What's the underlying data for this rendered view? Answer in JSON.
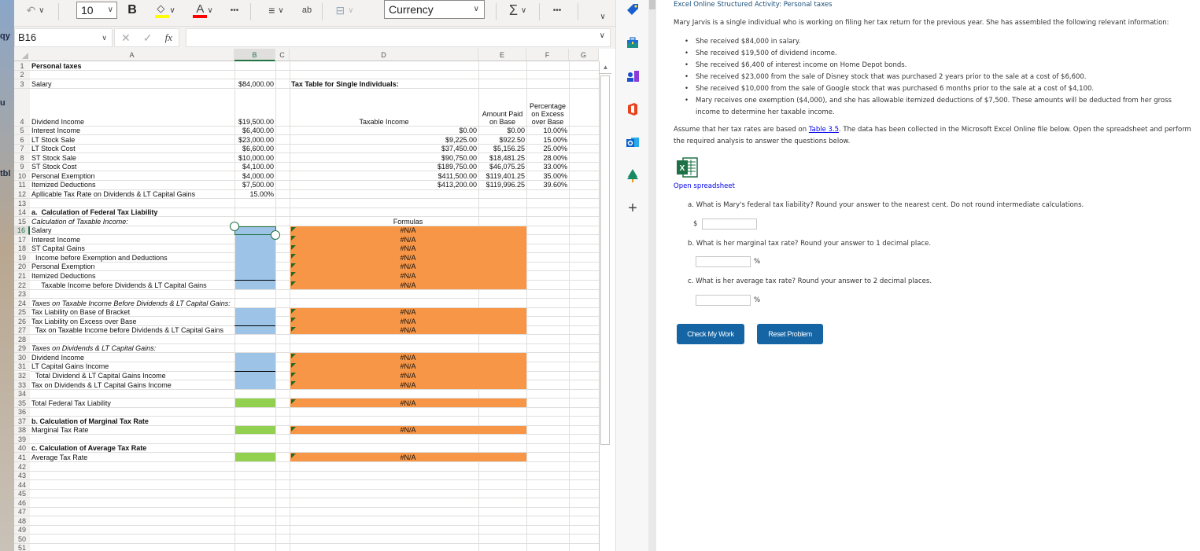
{
  "toolbar": {
    "undo_icon": "undo-icon",
    "font_size": "10",
    "bold_label": "B",
    "fill_color": "#ffff00",
    "font_color": "#ff0000",
    "font_color_label": "A",
    "more_label": "•••",
    "wrap_label": "ab",
    "number_format": "Currency",
    "autosum_label": "Σ",
    "more2_label": "•••"
  },
  "formula_bar": {
    "name_box": "B16",
    "cancel_label": "✕",
    "enter_label": "✓",
    "fx_label": "fx",
    "formula_value": ""
  },
  "grid": {
    "columns": [
      "A",
      "B",
      "C",
      "D",
      "E",
      "F",
      "G"
    ],
    "selected_cell": "B16",
    "rows": [
      "1",
      "2",
      "3",
      "4",
      "5",
      "6",
      "7",
      "8",
      "9",
      "10",
      "11",
      "12",
      "13",
      "14",
      "15",
      "16",
      "17",
      "18",
      "19",
      "20",
      "21",
      "22",
      "23",
      "24",
      "25",
      "26",
      "27",
      "28",
      "29",
      "30",
      "31",
      "32",
      "33",
      "34",
      "35",
      "36",
      "37",
      "38",
      "39",
      "40",
      "41",
      "42",
      "43",
      "44",
      "45",
      "46",
      "47",
      "48",
      "49",
      "50",
      "51"
    ],
    "colA": {
      "r1": "Personal taxes",
      "r3": "Salary",
      "r4": "Dividend Income",
      "r5": "Interest Income",
      "r6": "LT Stock Sale",
      "r7": "LT Stock Cost",
      "r8": "ST Stock Sale",
      "r9": "ST Stock Cost",
      "r10": "Personal Exemption",
      "r11": "Itemized Deductions",
      "r12": "Apllicable Tax Rate on Dividends & LT Capital Gains",
      "r14": "a.  Calculation of Federal Tax Liability",
      "r15": "Calculation of Taxable Income:",
      "r16": "Salary",
      "r17": "Interest Income",
      "r18": "ST Capital Gains",
      "r19": "  Income before Exemption and Deductions",
      "r20": "Personal Exemption",
      "r21": "Itemized Deductions",
      "r22": "     Taxable Income before Dividends & LT Capital Gains",
      "r24": "Taxes on Taxable Income Before Dividends & LT Capital Gains:",
      "r25": "Tax Liability on Base of Bracket",
      "r26": "Tax Liability on Excess over Base",
      "r27": "  Tax on Taxable Income before Dividends & LT Capital Gains",
      "r29": "Taxes on Dividends & LT Capital Gains:",
      "r30": "Dividend Income",
      "r31": "LT Capital Gains Income",
      "r32": "  Total Dividend & LT Capital Gains Income",
      "r33": "Tax on Dividends & LT Capital Gains Income",
      "r35": "Total Federal Tax Liability",
      "r37": "b. Calculation of Marginal Tax Rate",
      "r38": "Marginal Tax Rate",
      "r40": "c. Calculation of Average Tax Rate",
      "r41": "Average Tax Rate"
    },
    "colB": {
      "r3": "$84,000.00",
      "r4": "$19,500.00",
      "r5": "$6,400.00",
      "r6": "$23,000.00",
      "r7": "$6,600.00",
      "r8": "$10,000.00",
      "r9": "$4,100.00",
      "r10": "$4,000.00",
      "r11": "$7,500.00",
      "r12": "15.00%"
    },
    "tax_table": {
      "title": "Tax Table for Single Individuals:",
      "headers": {
        "taxable_income": "Taxable Income",
        "amount_paid": "Amount Paid on Base",
        "percentage": "Percentage on Excess over Base"
      },
      "rows": [
        {
          "income": "$0.00",
          "base": "$0.00",
          "pct": "10.00%"
        },
        {
          "income": "$9,225.00",
          "base": "$922.50",
          "pct": "15.00%"
        },
        {
          "income": "$37,450.00",
          "base": "$5,156.25",
          "pct": "25.00%"
        },
        {
          "income": "$90,750.00",
          "base": "$18,481.25",
          "pct": "28.00%"
        },
        {
          "income": "$189,750.00",
          "base": "$46,075.25",
          "pct": "33.00%"
        },
        {
          "income": "$411,500.00",
          "base": "$119,401.25",
          "pct": "35.00%"
        },
        {
          "income": "$413,200.00",
          "base": "$119,996.25",
          "pct": "39.60%"
        }
      ]
    },
    "formulas_header": "Formulas",
    "na_value": "#N/A"
  },
  "sidebar_icons": [
    "tag-icon",
    "toolbox-icon",
    "chess-icon",
    "office-icon",
    "outlook-icon",
    "tree-icon",
    "add-icon"
  ],
  "sidebar_add": "+",
  "panel": {
    "title": "Excel Online Structured Activity: Personal taxes",
    "intro": "Mary Jarvis is a single individual who is working on filing her tax return for the previous year. She has assembled the following relevant information:",
    "bullets": [
      "She received $84,000 in salary.",
      "She received $19,500 of dividend income.",
      "She received $6,400 of interest income on Home Depot bonds.",
      "She received $23,000 from the sale of Disney stock that was purchased 2 years prior to the sale at a cost of $6,600.",
      "She received $10,000 from the sale of Google stock that was purchased 6 months prior to the sale at a cost of $4,100.",
      "Mary receives one exemption ($4,000), and she has allowable itemized deductions of $7,500. These amounts will be deducted from her gross income to determine her taxable income."
    ],
    "assume_before": "Assume that her tax rates are based on ",
    "assume_link": "Table 3.5",
    "assume_after": ". The data has been collected in the Microsoft Excel Online file below. Open the spreadsheet and perform the required analysis to answer the questions below.",
    "open_spreadsheet": "Open spreadsheet",
    "questions": [
      {
        "text": "a. What is Mary's federal tax liability? Round your answer to the nearest cent. Do not round intermediate calculations.",
        "prefix": "$",
        "suffix": "",
        "value": ""
      },
      {
        "text": "b. What is her marginal tax rate? Round your answer to 1 decimal place.",
        "prefix": "",
        "suffix": "%",
        "value": ""
      },
      {
        "text": "c. What is her average tax rate? Round your answer to 2 decimal places.",
        "prefix": "",
        "suffix": "%",
        "value": ""
      }
    ],
    "check_button": "Check My Work",
    "reset_button": "Reset Problem"
  }
}
